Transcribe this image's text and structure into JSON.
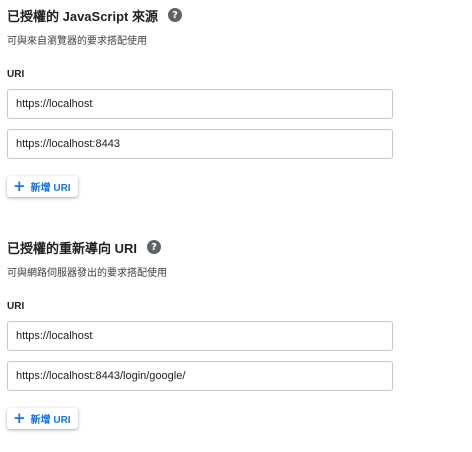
{
  "js_origins": {
    "title": "已授權的 JavaScript 來源",
    "help_icon": "?",
    "subtitle": "可與來自瀏覽器的要求搭配使用",
    "uri_label": "URI",
    "uris": [
      "https://localhost",
      "https://localhost:8443"
    ],
    "add_button": {
      "icon": "+",
      "label": "新增 URI"
    }
  },
  "redirect_uris": {
    "title": "已授權的重新導向 URI",
    "help_icon": "?",
    "subtitle": "可與網路伺服器發出的要求搭配使用",
    "uri_label": "URI",
    "uris": [
      "https://localhost",
      "https://localhost:8443/login/google/"
    ],
    "add_button": {
      "icon": "+",
      "label": "新增 URI"
    }
  },
  "colors": {
    "accent": "#1a73e8",
    "help_icon_bg": "#5f6368",
    "input_border": "#c8c8c8"
  }
}
